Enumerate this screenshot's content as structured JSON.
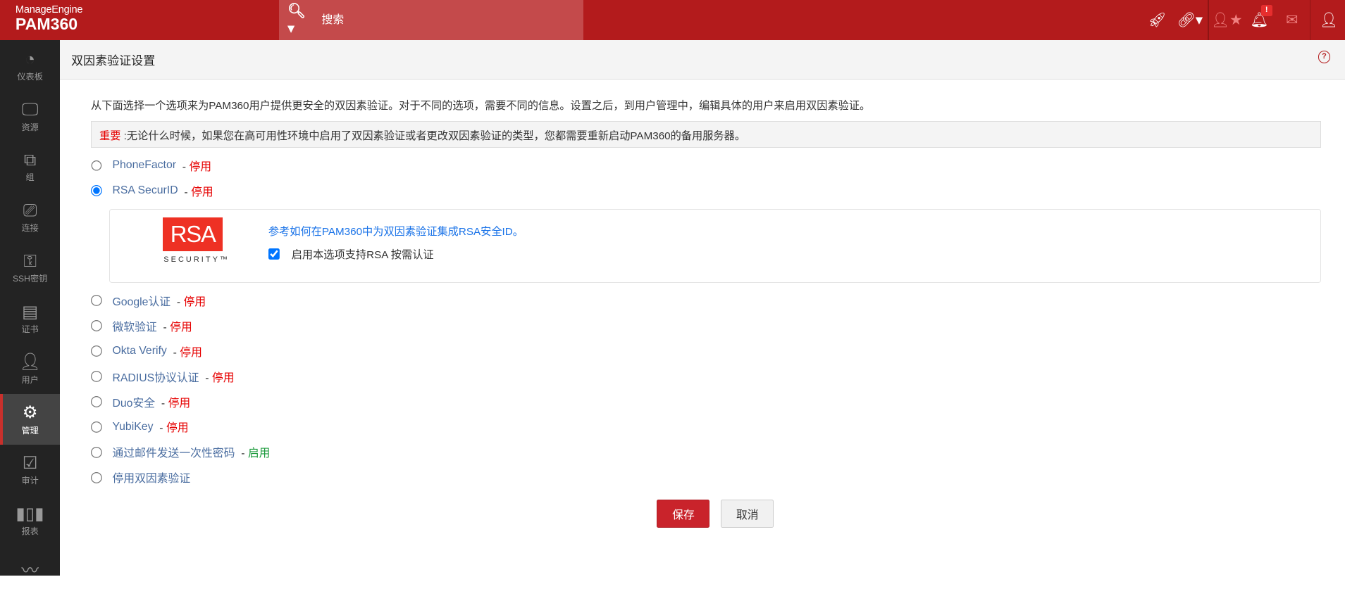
{
  "header": {
    "brand": "ManageEngine",
    "product": "PAM360",
    "search_placeholder": "搜索"
  },
  "sidebar": [
    {
      "label": "仪表板",
      "icon": "dashboard-icon"
    },
    {
      "label": "资源",
      "icon": "monitor-icon"
    },
    {
      "label": "组",
      "icon": "groups-icon"
    },
    {
      "label": "连接",
      "icon": "connections-icon"
    },
    {
      "label": "SSH密钥",
      "icon": "ssh-key-icon"
    },
    {
      "label": "证书",
      "icon": "certificate-icon"
    },
    {
      "label": "用户",
      "icon": "user-icon"
    },
    {
      "label": "管理",
      "icon": "gear-icon",
      "active": true
    },
    {
      "label": "审计",
      "icon": "clipboard-icon"
    },
    {
      "label": "报表",
      "icon": "bar-chart-icon"
    },
    {
      "label": "",
      "icon": "trend-icon"
    }
  ],
  "page": {
    "title": "双因素验证设置",
    "intro": "从下面选择一个选项来为PAM360用户提供更安全的双因素验证。对于不同的选项，需要不同的信息。设置之后，到用户管理中，编辑具体的用户来启用双因素验证。",
    "notice_label": "重要",
    "notice_text": " :无论什么时候，如果您在高可用性环境中启用了双因素验证或者更改双因素验证的类型，您都需要重新启动PAM360的备用服务器。"
  },
  "options": [
    {
      "label": "PhoneFactor",
      "status": "停用"
    },
    {
      "label": "RSA SecurID ",
      "status": "停用",
      "selected": true
    },
    {
      "label": "Google认证",
      "status": "停用"
    },
    {
      "label": "微软验证",
      "status": "停用"
    },
    {
      "label": "Okta Verify",
      "status": "停用"
    },
    {
      "label": "RADIUS协议认证",
      "status": "停用"
    },
    {
      "label": "Duo安全",
      "status": "停用"
    },
    {
      "label": "YubiKey",
      "status": "停用"
    },
    {
      "label": "通过邮件发送一次性密码",
      "status": "启用"
    },
    {
      "label": "停用双因素验证",
      "status": ""
    }
  ],
  "rsa": {
    "logo_text": "RSA",
    "logo_sub": "SECURITY™",
    "link": "参考如何在PAM360中为双因素验证集成RSA安全ID。",
    "checkbox_label": "启用本选项支持RSA 按需认证",
    "checked": true
  },
  "buttons": {
    "save": "保存",
    "cancel": "取消"
  },
  "colors": {
    "header": "#b31b1c",
    "disabled": "#e60000",
    "enabled": "#1c9a3c"
  }
}
